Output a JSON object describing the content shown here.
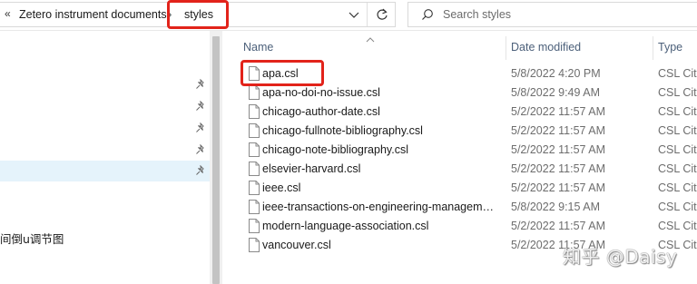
{
  "address_bar": {
    "overflow_chevron": "«",
    "parent_folder": "Zetero instrument documents",
    "separator": "›",
    "current_folder": "styles"
  },
  "search": {
    "placeholder": "Search styles",
    "value": ""
  },
  "navigation_pane": {
    "pinned_items": 5,
    "selected_index": 4,
    "partial_label": "间倒u调节图"
  },
  "columns": {
    "name": "Name",
    "date_modified": "Date modified",
    "type": "Type",
    "sorted_by": "Name"
  },
  "files": [
    {
      "name": "apa.csl",
      "date": "5/8/2022 4:20 PM",
      "type": "CSL Citation Style"
    },
    {
      "name": "apa-no-doi-no-issue.csl",
      "date": "5/8/2022 9:49 AM",
      "type": "CSL Citation Style"
    },
    {
      "name": "chicago-author-date.csl",
      "date": "5/2/2022 11:57 AM",
      "type": "CSL Citation Style"
    },
    {
      "name": "chicago-fullnote-bibliography.csl",
      "date": "5/2/2022 11:57 AM",
      "type": "CSL Citation Style"
    },
    {
      "name": "chicago-note-bibliography.csl",
      "date": "5/2/2022 11:57 AM",
      "type": "CSL Citation Style"
    },
    {
      "name": "elsevier-harvard.csl",
      "date": "5/2/2022 11:57 AM",
      "type": "CSL Citation Style"
    },
    {
      "name": "ieee.csl",
      "date": "5/2/2022 11:57 AM",
      "type": "CSL Citation Style"
    },
    {
      "name": "ieee-transactions-on-engineering-managemen...",
      "date": "5/8/2022 9:15 AM",
      "type": "CSL Citation Style"
    },
    {
      "name": "modern-language-association.csl",
      "date": "5/2/2022 11:57 AM",
      "type": "CSL Citation Style"
    },
    {
      "name": "vancouver.csl",
      "date": "5/2/2022 11:57 AM",
      "type": "CSL Citation Style"
    }
  ],
  "highlights": {
    "color": "#e2231a",
    "targets": [
      "styles",
      "apa.csl"
    ]
  },
  "watermark": "知乎 @Daisy",
  "colors": {
    "selected_row": "#e5f3fb",
    "header_text": "#4c607a",
    "secondary_text": "#6d6d6d"
  },
  "icons": [
    "double-chevron-left-icon",
    "chevron-right-icon",
    "chevron-down-icon",
    "refresh-icon",
    "search-icon",
    "pin-icon",
    "file-icon",
    "sort-ascending-icon"
  ]
}
